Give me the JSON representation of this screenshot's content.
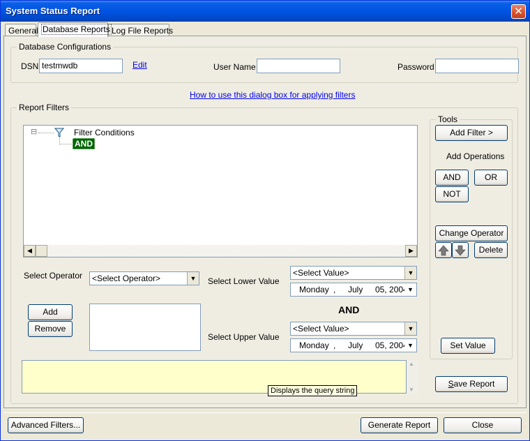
{
  "window": {
    "title": "System Status Report",
    "close_glyph": "✕"
  },
  "tabs": [
    {
      "label": "General",
      "active": false
    },
    {
      "label": "Database Reports",
      "active": true
    },
    {
      "label": "Log File Reports",
      "active": false
    }
  ],
  "db_config": {
    "group_label": "Database Configurations",
    "dsn_label": "DSN",
    "dsn_value": "testmwdb",
    "edit_link": "Edit",
    "username_label": "User Name",
    "username_value": "",
    "password_label": "Password",
    "password_value": ""
  },
  "help_link": "How to use this dialog box for applying filters",
  "report_filters": {
    "group_label": "Report Filters",
    "tree": {
      "root_label": "Filter Conditions",
      "expander_glyph": "⊟",
      "child_label": "AND"
    },
    "select_operator_label": "Select Operator",
    "operator_combo": "<Select Operator>",
    "lower_label": "Select Lower Value",
    "lower_combo": "<Select Value>",
    "lower_date": {
      "day": "Monday",
      "sep": ",",
      "month": "July",
      "date": "05, 2004"
    },
    "and_label": "AND",
    "upper_label": "Select Upper Value",
    "upper_combo": "<Select Value>",
    "upper_date": {
      "day": "Monday",
      "sep": ",",
      "month": "July",
      "date": "05, 2004"
    },
    "add_button": "Add",
    "remove_button": "Remove",
    "query_tooltip": "Displays the query string",
    "query_value": ""
  },
  "tools": {
    "group_label": "Tools",
    "add_filter_button": "Add Filter >",
    "add_operations_label": "Add Operations",
    "and_button": "AND",
    "or_button": "OR",
    "not_button": "NOT",
    "change_operator_button": "Change Operator",
    "delete_button": "Delete",
    "set_value_button": "Set Value"
  },
  "save_report_button": "Save Report",
  "footer": {
    "advanced_filters_button": "Advanced Filters...",
    "generate_report_button": "Generate Report",
    "close_button": "Close"
  }
}
